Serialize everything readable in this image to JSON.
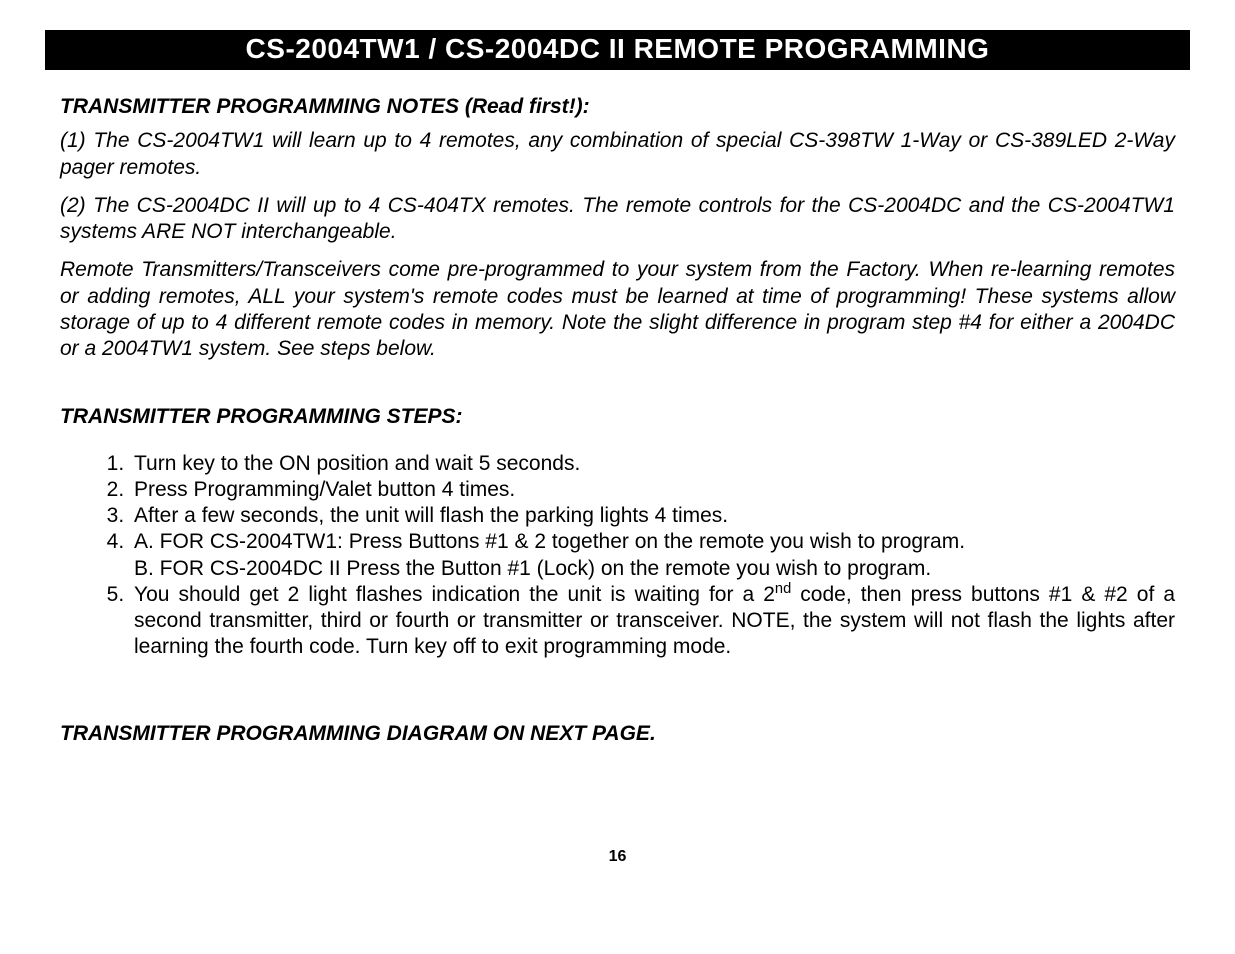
{
  "banner": "CS-2004TW1 / CS-2004DC II REMOTE PROGRAMMING",
  "notes_heading": "TRANSMITTER PROGRAMMING NOTES (Read first!):",
  "notes_para1": "(1) The CS-2004TW1 will learn up to 4 remotes, any combination of special CS-398TW 1-Way or CS-389LED 2-Way pager remotes.",
  "notes_para2": "(2) The CS-2004DC II will up to 4 CS-404TX remotes.  The remote controls for the CS-2004DC and the CS-2004TW1 systems ARE NOT interchangeable.",
  "notes_para3": "Remote Transmitters/Transceivers come pre-programmed to your system from the Factory.  When re-learning remotes or adding remotes, ALL your system's remote codes must be learned at time of programming!  These systems allow storage of up to 4 different remote codes in memory.  Note the slight difference in program step #4 for either a 2004DC or a 2004TW1 system. See steps below.",
  "steps_heading": "TRANSMITTER PROGRAMMING STEPS:",
  "steps": {
    "s1": "Turn key to the ON position and wait 5 seconds.",
    "s2": "Press Programming/Valet button 4 times.",
    "s3": "After a few seconds, the unit will flash the parking lights 4 times.",
    "s4a": "A. FOR CS-2004TW1: Press Buttons #1 & 2 together on the remote you wish to program.",
    "s4b": "B. FOR CS-2004DC II Press the Button #1 (Lock) on the remote you wish to program.",
    "s5_pre": "You should get 2 light flashes indication the unit is waiting for a 2",
    "s5_sup": "nd",
    "s5_post": " code, then press buttons #1 & #2 of a second transmitter, third or fourth or transmitter or transceiver.  NOTE, the system will not flash the lights after learning the fourth code.  Turn key off to exit programming mode."
  },
  "diagram_heading": "TRANSMITTER PROGRAMMING DIAGRAM ON NEXT PAGE.",
  "page_number": "16"
}
